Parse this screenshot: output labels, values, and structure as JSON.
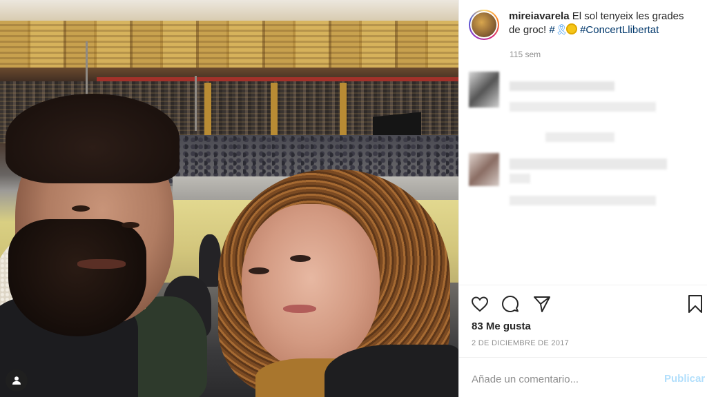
{
  "post": {
    "username": "mireiavarela",
    "caption_text": "El sol tenyeix les grades de groc!",
    "hashtag_1": "#",
    "ribbon_glyph": "🎗",
    "hashtag_2": "#ConcertLlibertat",
    "time_ago": "115 sem",
    "likes": "83 Me gusta",
    "date": "2 DE DICIEMBRE DE 2017"
  },
  "comment_box": {
    "placeholder": "Añade un comentario...",
    "post_label": "Publicar"
  },
  "icons": {
    "like": "heart-icon",
    "comment": "comment-icon",
    "share": "paper-plane-icon",
    "save": "bookmark-icon",
    "tagged_users": "user-icon"
  },
  "colors": {
    "hashtag": "#00376b",
    "publish_disabled": "#b2dffc",
    "muted_text": "#8e8e8e"
  }
}
